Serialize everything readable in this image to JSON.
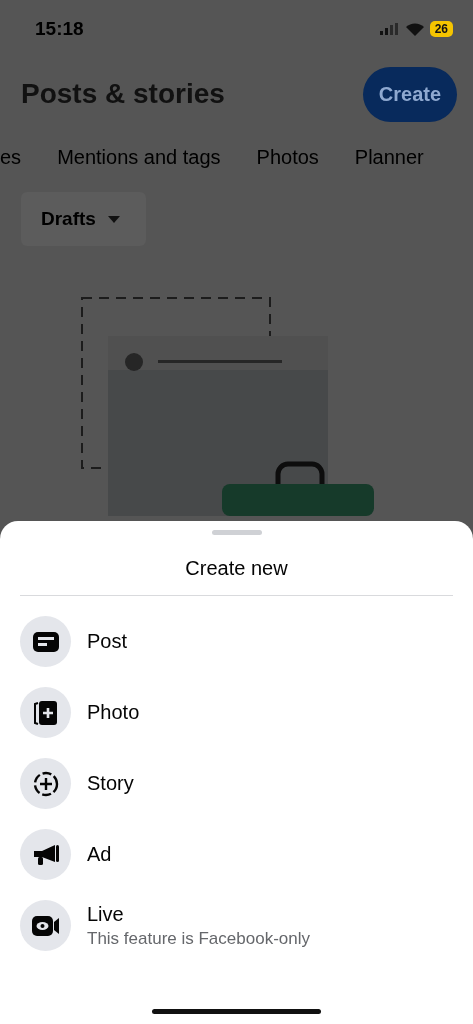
{
  "status_bar": {
    "time": "15:18",
    "battery": "26"
  },
  "header": {
    "title": "Posts & stories",
    "create_button": "Create"
  },
  "tabs": [
    {
      "label": "es"
    },
    {
      "label": "Mentions and tags"
    },
    {
      "label": "Photos"
    },
    {
      "label": "Planner"
    }
  ],
  "filter": {
    "label": "Drafts"
  },
  "sheet": {
    "title": "Create new",
    "items": [
      {
        "label": "Post"
      },
      {
        "label": "Photo"
      },
      {
        "label": "Story"
      },
      {
        "label": "Ad"
      },
      {
        "label": "Live",
        "subtitle": "This feature is Facebook-only"
      }
    ]
  }
}
